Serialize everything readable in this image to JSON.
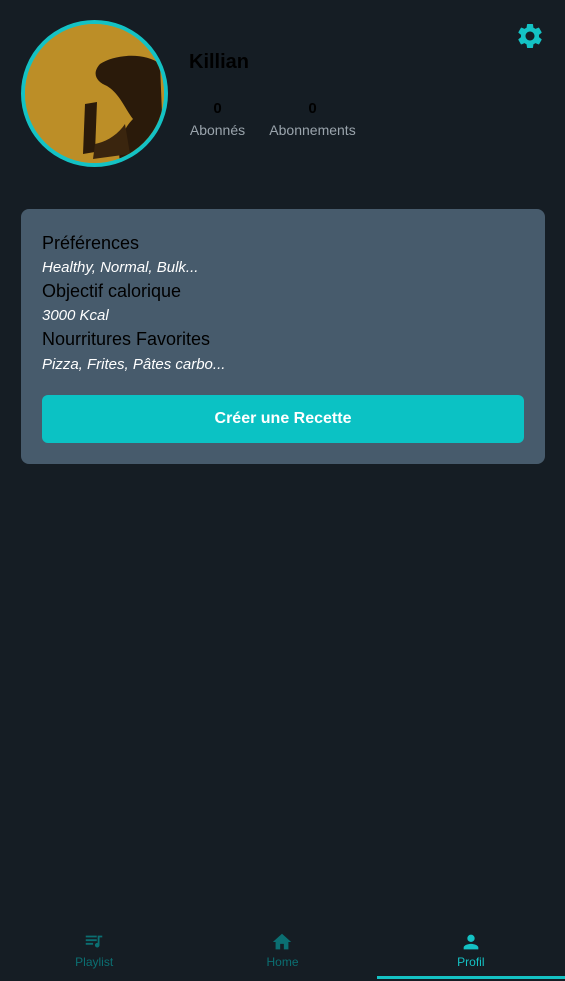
{
  "colors": {
    "background": "#151d24",
    "accent": "#14c2c4",
    "card": "#475b6c",
    "inactive_nav": "#0b6f72"
  },
  "profile": {
    "username": "Killian",
    "followers_count": "0",
    "followers_label": "Abonnés",
    "following_count": "0",
    "following_label": "Abonnements",
    "settings_icon": "gear-icon"
  },
  "card": {
    "preferences_title": "Préférences",
    "preferences_value": "Healthy, Normal, Bulk...",
    "calorie_title": "Objectif calorique",
    "calorie_value": "3000 Kcal",
    "favorites_title": "Nourritures Favorites",
    "favorites_value": "Pizza, Frites, Pâtes carbo...",
    "create_button": "Créer une Recette"
  },
  "nav": {
    "items": [
      {
        "label": "Playlist",
        "icon": "playlist-icon",
        "active": false
      },
      {
        "label": "Home",
        "icon": "home-icon",
        "active": false
      },
      {
        "label": "Profil",
        "icon": "person-icon",
        "active": true
      }
    ]
  }
}
